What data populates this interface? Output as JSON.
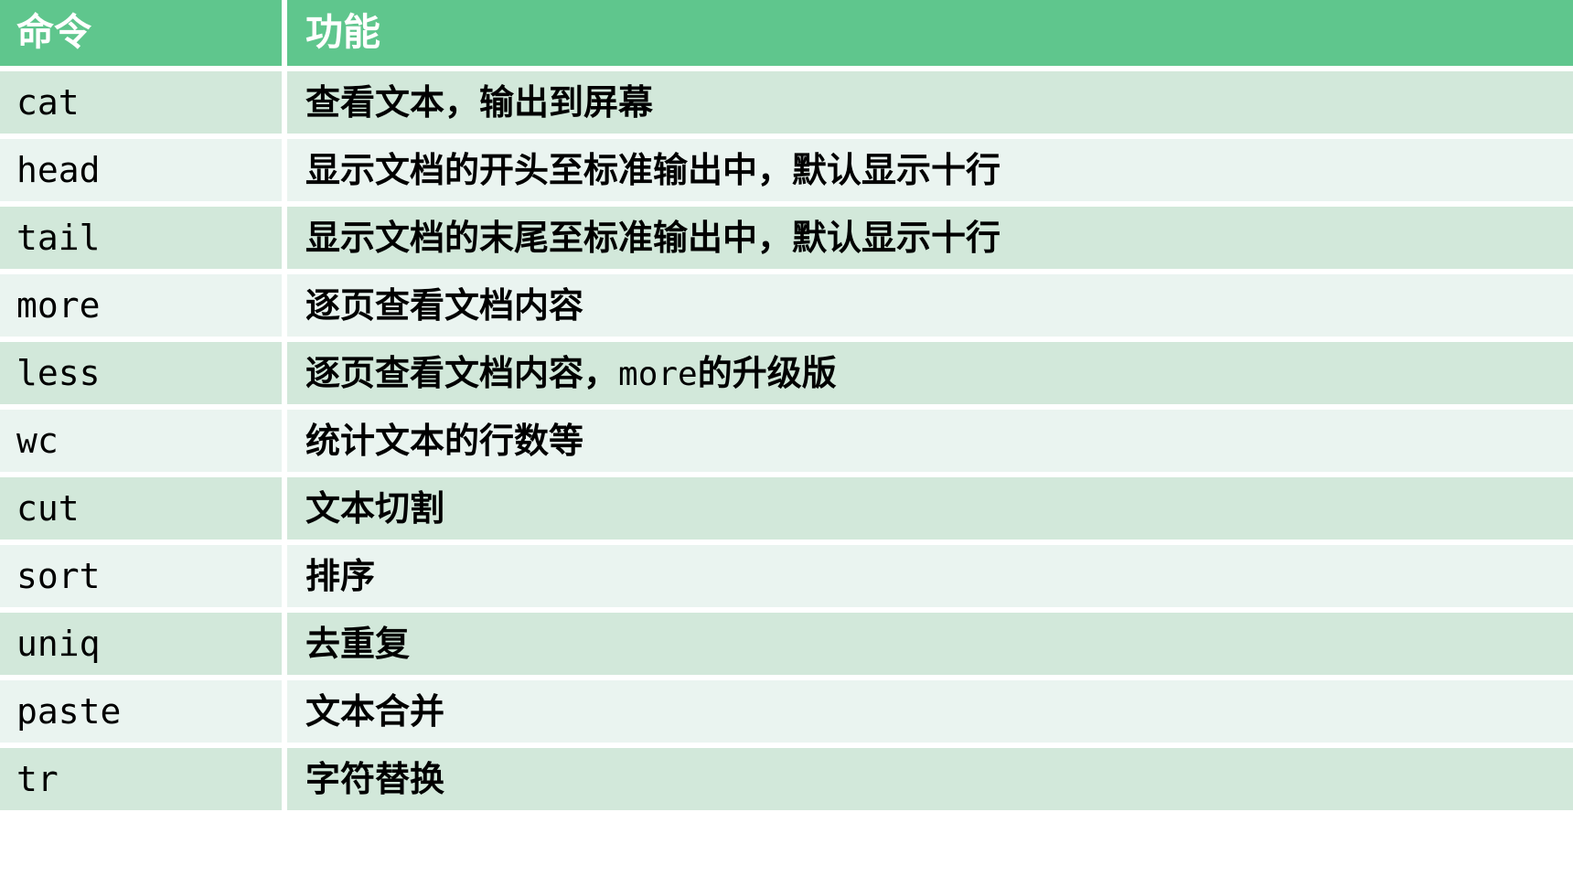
{
  "table": {
    "columns": [
      {
        "key": "command",
        "label": "命令"
      },
      {
        "key": "function",
        "label": "功能"
      }
    ],
    "colors": {
      "header_background": "#5FC68D",
      "header_text": "#FFFFFF",
      "row_dark": "#D2E8DA",
      "row_light": "#EAF4F0",
      "body_text": "#000000",
      "grid_gap": "#FFFFFF"
    },
    "rows": [
      {
        "command": "cat",
        "function": "查看文本，输出到屏幕"
      },
      {
        "command": "head",
        "function": "显示文档的开头至标准输出中，默认显示十行"
      },
      {
        "command": "tail",
        "function": "显示文档的末尾至标准输出中，默认显示十行"
      },
      {
        "command": "more",
        "function": "逐页查看文档内容"
      },
      {
        "command": "less",
        "function_prefix": "逐页查看文档内容，",
        "function_mono": "more",
        "function_suffix": "的升级版",
        "function": "逐页查看文档内容，more的升级版"
      },
      {
        "command": "wc",
        "function": "统计文本的行数等"
      },
      {
        "command": "cut",
        "function": "文本切割"
      },
      {
        "command": "sort",
        "function": "排序"
      },
      {
        "command": "uniq",
        "function": "去重复"
      },
      {
        "command": "paste",
        "function": "文本合并"
      },
      {
        "command": "tr",
        "function": "字符替换"
      }
    ]
  }
}
